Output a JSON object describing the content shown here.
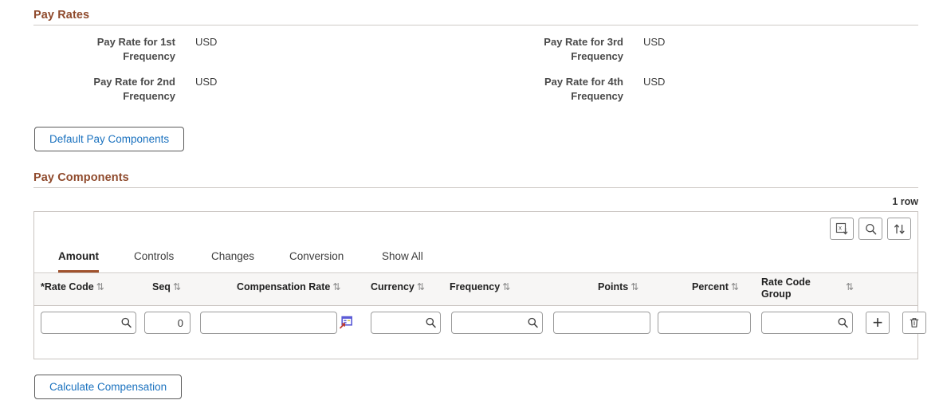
{
  "pay_rates": {
    "heading": "Pay Rates",
    "fields": [
      {
        "label": "Pay Rate for 1st Frequency",
        "value": "USD"
      },
      {
        "label": "Pay Rate for 2nd Frequency",
        "value": "USD"
      },
      {
        "label": "Pay Rate for 3rd Frequency",
        "value": "USD"
      },
      {
        "label": "Pay Rate for 4th Frequency",
        "value": "USD"
      }
    ],
    "default_pay_components_label": "Default Pay Components"
  },
  "pay_components": {
    "heading": "Pay Components",
    "row_count": "1 row",
    "toolbar": {
      "export_icon": "export-to-excel-icon",
      "find_icon": "search-icon",
      "sort_icon": "sort-icon"
    },
    "tabs": [
      {
        "label": "Amount",
        "active": true
      },
      {
        "label": "Controls",
        "active": false
      },
      {
        "label": "Changes",
        "active": false
      },
      {
        "label": "Conversion",
        "active": false
      },
      {
        "label": "Show All",
        "active": false
      }
    ],
    "columns": [
      {
        "label": "*Rate Code",
        "required": true,
        "sort": "⇅"
      },
      {
        "label": "Seq",
        "required": false,
        "sort": "⇅"
      },
      {
        "label": "Compensation Rate",
        "required": false,
        "sort": "⇅"
      },
      {
        "label": "Currency",
        "required": false,
        "sort": "⇅"
      },
      {
        "label": "Frequency",
        "required": false,
        "sort": "⇅"
      },
      {
        "label": "Points",
        "required": false,
        "sort": "⇅"
      },
      {
        "label": "Percent",
        "required": false,
        "sort": "⇅"
      },
      {
        "label": "Rate Code Group",
        "required": false,
        "sort": "⇅"
      }
    ],
    "row": {
      "rate_code": "",
      "seq": "0",
      "compensation_rate": "",
      "currency": "",
      "frequency": "",
      "points": "",
      "percent": "",
      "rate_code_group": "",
      "add_row_label": "+",
      "delete_row_label": "delete-row"
    },
    "calculate_compensation_label": "Calculate Compensation"
  },
  "colors": {
    "heading": "#8f4a2c",
    "active_tab_underline": "#a0522d",
    "link": "#1b72bf",
    "border": "#c9c4c0",
    "header_bg": "#f7f6f5"
  }
}
